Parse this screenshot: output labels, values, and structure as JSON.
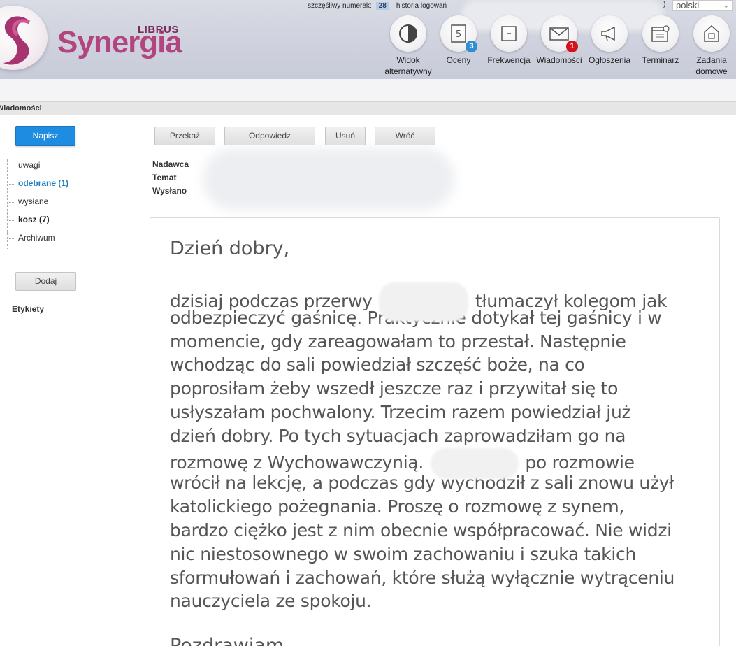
{
  "brand": {
    "librus": "LIBRUS",
    "synergia": "Synergia"
  },
  "topbar": {
    "lucky_label": "szczęśliwy numerek:",
    "lucky_number": "28",
    "login_history": "historia logowań",
    "closing_paren": ")"
  },
  "language": {
    "selected": "polski"
  },
  "nav": [
    {
      "label_line1": "Widok",
      "label_line2": "alternatywny",
      "icon": "contrast-icon"
    },
    {
      "label_line1": "Oceny",
      "label_line2": "",
      "icon": "grade-icon",
      "badge": "3"
    },
    {
      "label_line1": "Frekwencja",
      "label_line2": "",
      "icon": "attendance-icon"
    },
    {
      "label_line1": "Wiadomości",
      "label_line2": "",
      "icon": "envelope-icon",
      "badge": "1"
    },
    {
      "label_line1": "Ogłoszenia",
      "label_line2": "",
      "icon": "megaphone-icon"
    },
    {
      "label_line1": "Terminarz",
      "label_line2": "",
      "icon": "calendar-icon"
    },
    {
      "label_line1": "Zadania",
      "label_line2": "domowe",
      "icon": "homework-icon"
    }
  ],
  "section_title": "Wiadomości",
  "sidebar": {
    "compose": "Napisz",
    "folders": [
      "uwagi",
      "odebrane (1)",
      "wysłane",
      "kosz (7)",
      "Archiwum"
    ],
    "add": "Dodaj",
    "labels_heading": "Etykiety"
  },
  "toolbar": {
    "forward": "Przekaż",
    "reply": "Odpowiedz",
    "delete": "Usuń",
    "back": "Wróć"
  },
  "meta": {
    "sender": "Nadawca",
    "subject": "Temat",
    "sent": "Wysłano"
  },
  "message": {
    "greeting": "Dzień dobry,",
    "lines": [
      {
        "before": "dzisiaj podczas przerwy",
        "after": "tłumaczył kolegom jak",
        "redacted": true
      },
      {
        "text": "odbezpieczyć gaśnicę. Praktycznie dotykał tej gaśnicy i w"
      },
      {
        "text": "momencie, gdy zareagowałam to przestał. Następnie"
      },
      {
        "text": "wchodząc do sali powiedział szczęść boże, na co"
      },
      {
        "text": "poprosiłam żeby wszedł jeszcze raz i przywitał się to"
      },
      {
        "text": "usłyszałam pochwalony. Trzecim razem powiedział już"
      },
      {
        "text": "dzień dobry. Po tych sytuacjach zaprowadziłam go na"
      },
      {
        "before": "rozmowę z Wychowawczynią.",
        "after": "po rozmowie",
        "redacted": true
      },
      {
        "text": "wrócił na lekcję, a podczas gdy wychodził z sali znowu użył"
      },
      {
        "text": "katolickiego pożegnania. Proszę o rozmowę z synem,"
      },
      {
        "text": "bardzo ciężko jest z nim obecnie współpracować. Nie widzi"
      },
      {
        "text": "nic niestosownego w swoim zachowaniu i szuka takich"
      },
      {
        "text": "sformułowań i zachowań, które służą wyłącznie wytrąceniu"
      },
      {
        "text": "nauczyciela ze spokoju."
      }
    ],
    "closing": "Pozdrawiam"
  },
  "colors": {
    "brand_magenta": "#b2457f",
    "accent_blue": "#1e8ce0",
    "badge_red": "#d3121b",
    "badge_blue": "#2f8ed2"
  }
}
